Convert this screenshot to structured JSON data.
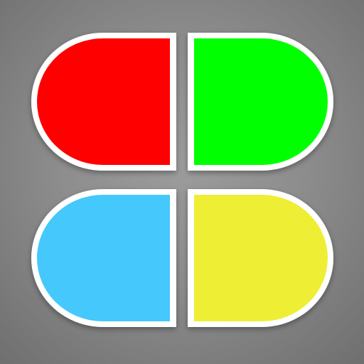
{
  "icon": {
    "shape": "four-petal-clover",
    "petals": [
      {
        "name": "top-left",
        "color": "#ff0000"
      },
      {
        "name": "top-right",
        "color": "#00ff00"
      },
      {
        "name": "bottom-left",
        "color": "#45c8fb"
      },
      {
        "name": "bottom-right",
        "color": "#eeee35"
      }
    ],
    "outline_color": "#ffffff",
    "background_color": "#8f8f8f"
  }
}
